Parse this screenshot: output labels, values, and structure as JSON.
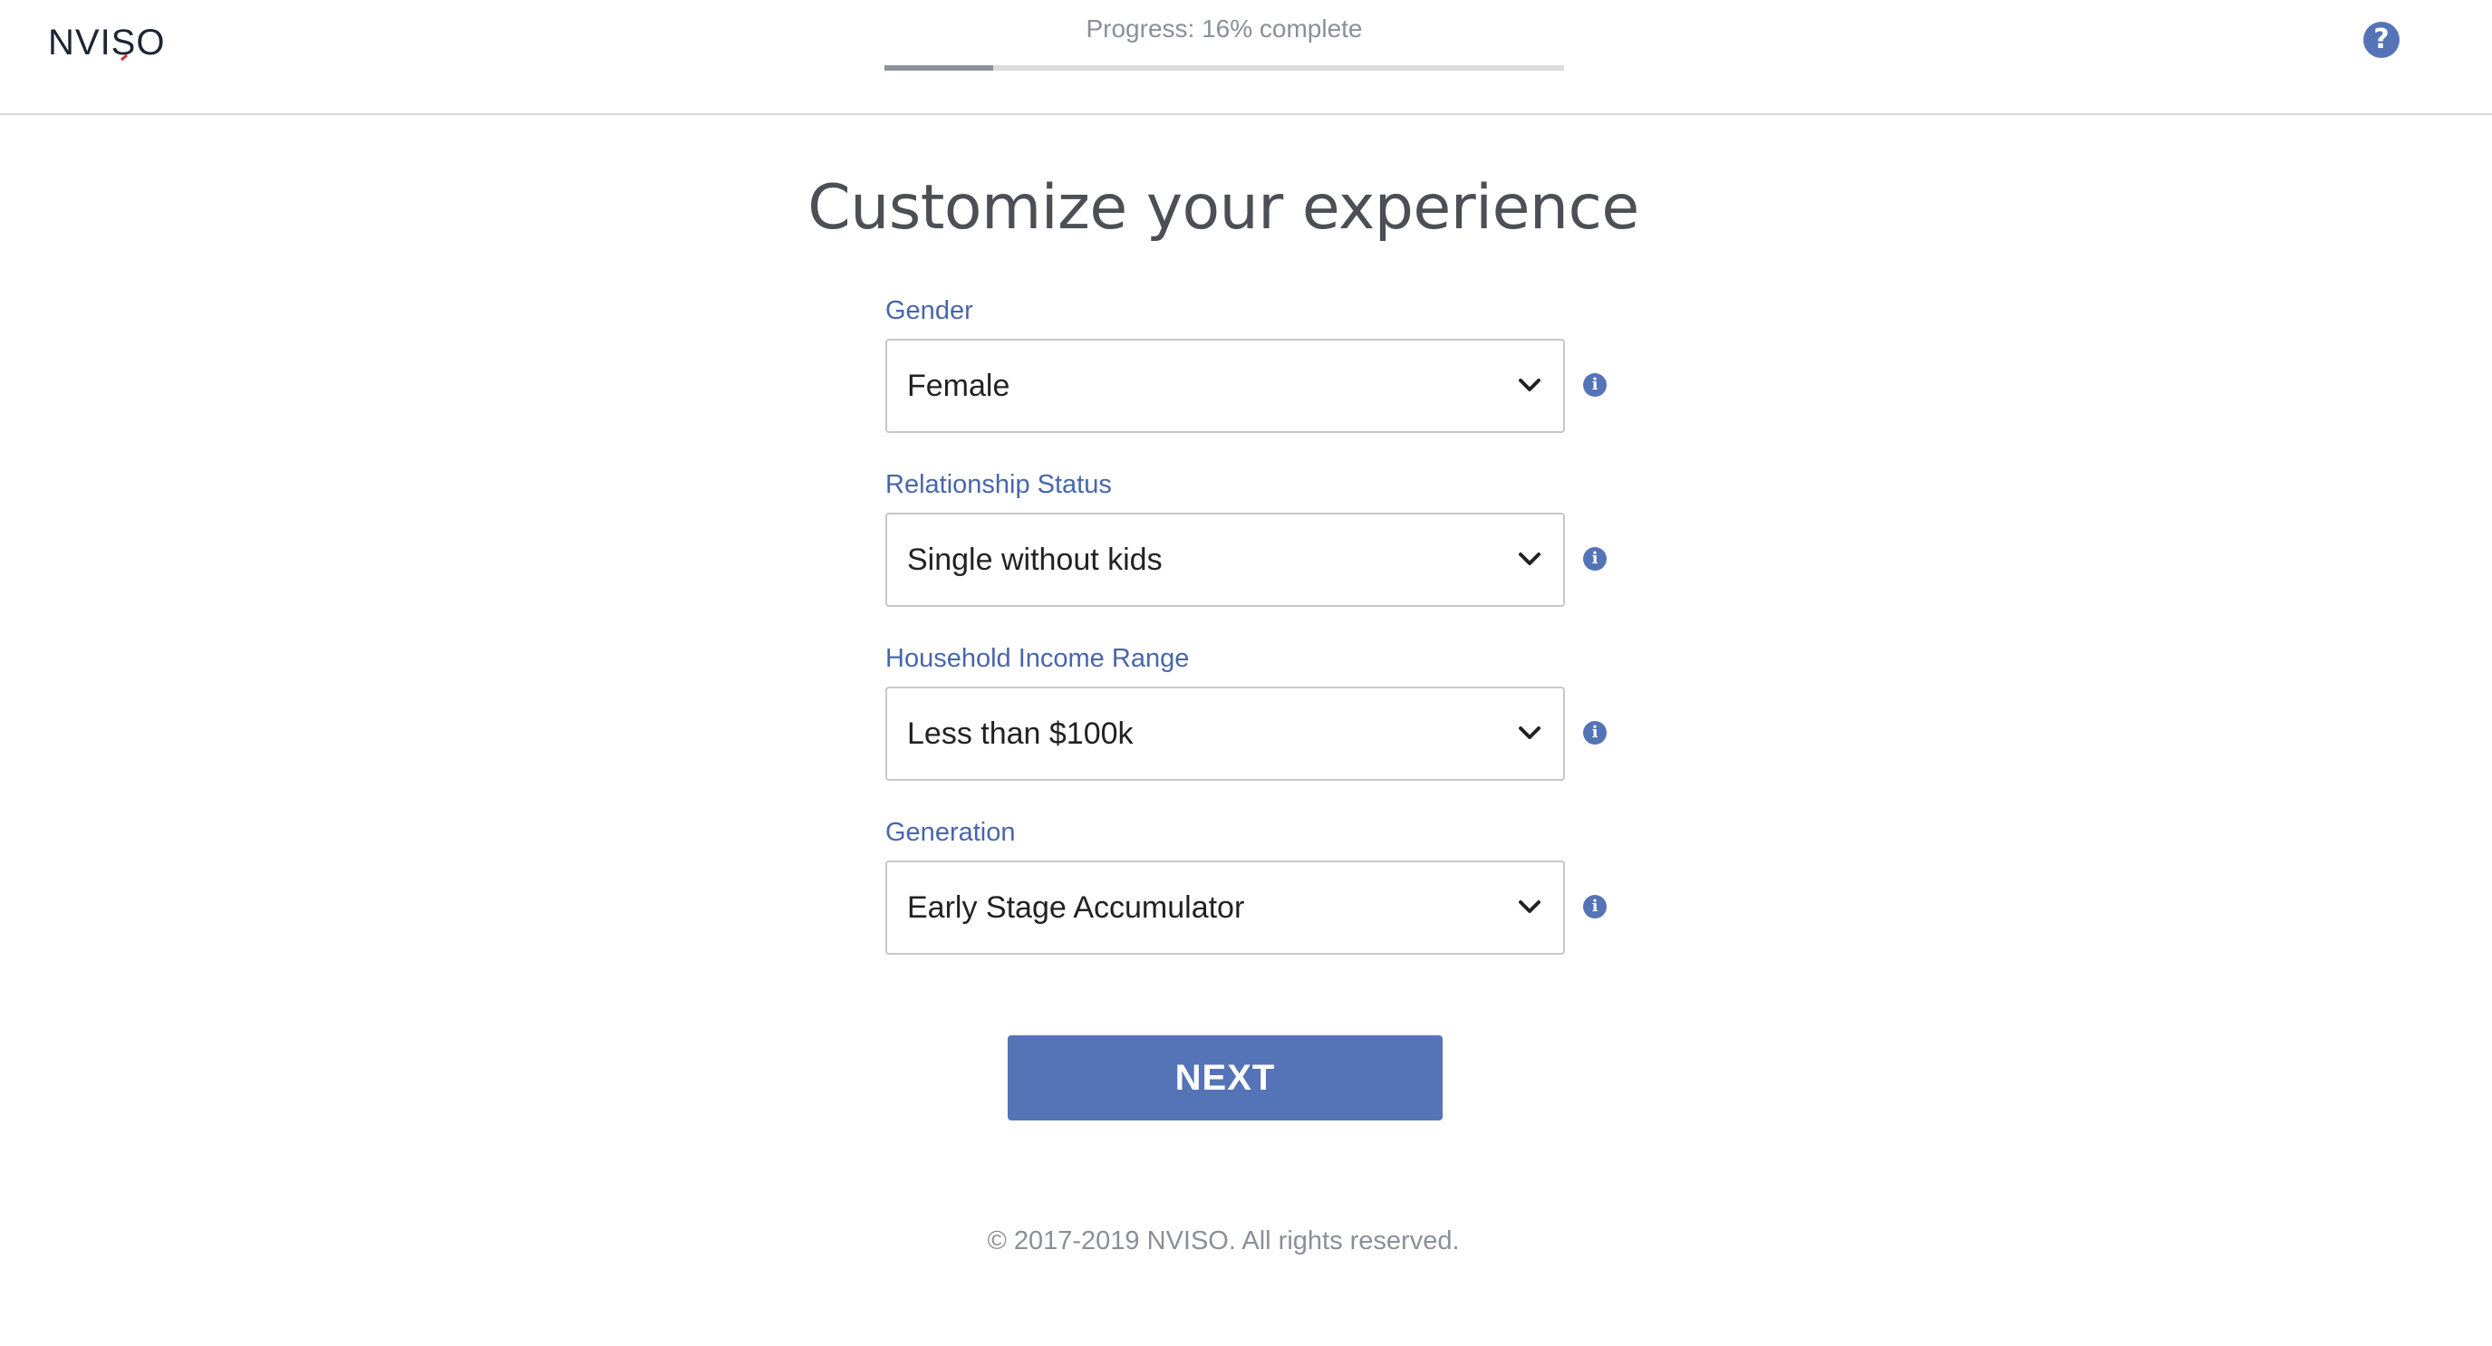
{
  "header": {
    "logo_text": "NVISO",
    "progress_label": "Progress: 16% complete",
    "progress_fraction": 0.16,
    "help_icon": "question-circle-icon"
  },
  "main": {
    "title": "Customize your experience",
    "fields": [
      {
        "label": "Gender",
        "value": "Female",
        "info_icon": "info-circle-icon"
      },
      {
        "label": "Relationship Status",
        "value": "Single without kids",
        "info_icon": "info-circle-icon"
      },
      {
        "label": "Household Income Range",
        "value": "Less than $100k",
        "info_icon": "info-circle-icon"
      },
      {
        "label": "Generation",
        "value": "Early Stage Accumulator",
        "info_icon": "info-circle-icon"
      }
    ],
    "next_label": "NEXT"
  },
  "footer": {
    "copyright": "© 2017-2019 NVISO. All rights reserved."
  },
  "colors": {
    "accent": "#5574b7",
    "label": "#4866aa",
    "muted": "#8a8f98"
  }
}
